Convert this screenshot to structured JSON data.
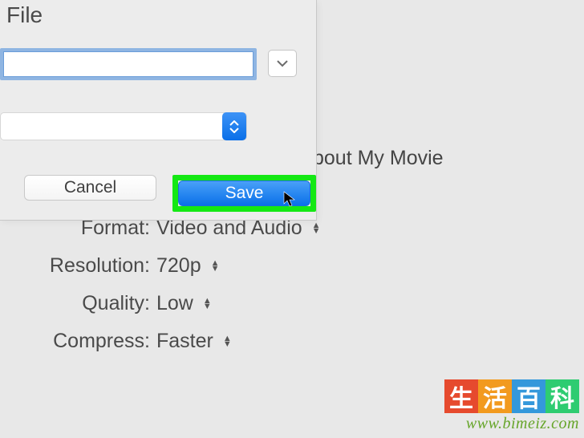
{
  "dialog": {
    "menu": "File",
    "name_value": "",
    "cancel_label": "Cancel",
    "save_label": "Save"
  },
  "background": {
    "title_fragment": "bout My Movie"
  },
  "options": {
    "format": {
      "label": "Format:",
      "value": "Video and Audio"
    },
    "resolution": {
      "label": "Resolution:",
      "value": "720p"
    },
    "quality": {
      "label": "Quality:",
      "value": "Low"
    },
    "compress": {
      "label": "Compress:",
      "value": "Faster"
    }
  },
  "watermark": {
    "chars": [
      "生",
      "活",
      "百",
      "科"
    ],
    "url": "www.bimeiz.com"
  }
}
